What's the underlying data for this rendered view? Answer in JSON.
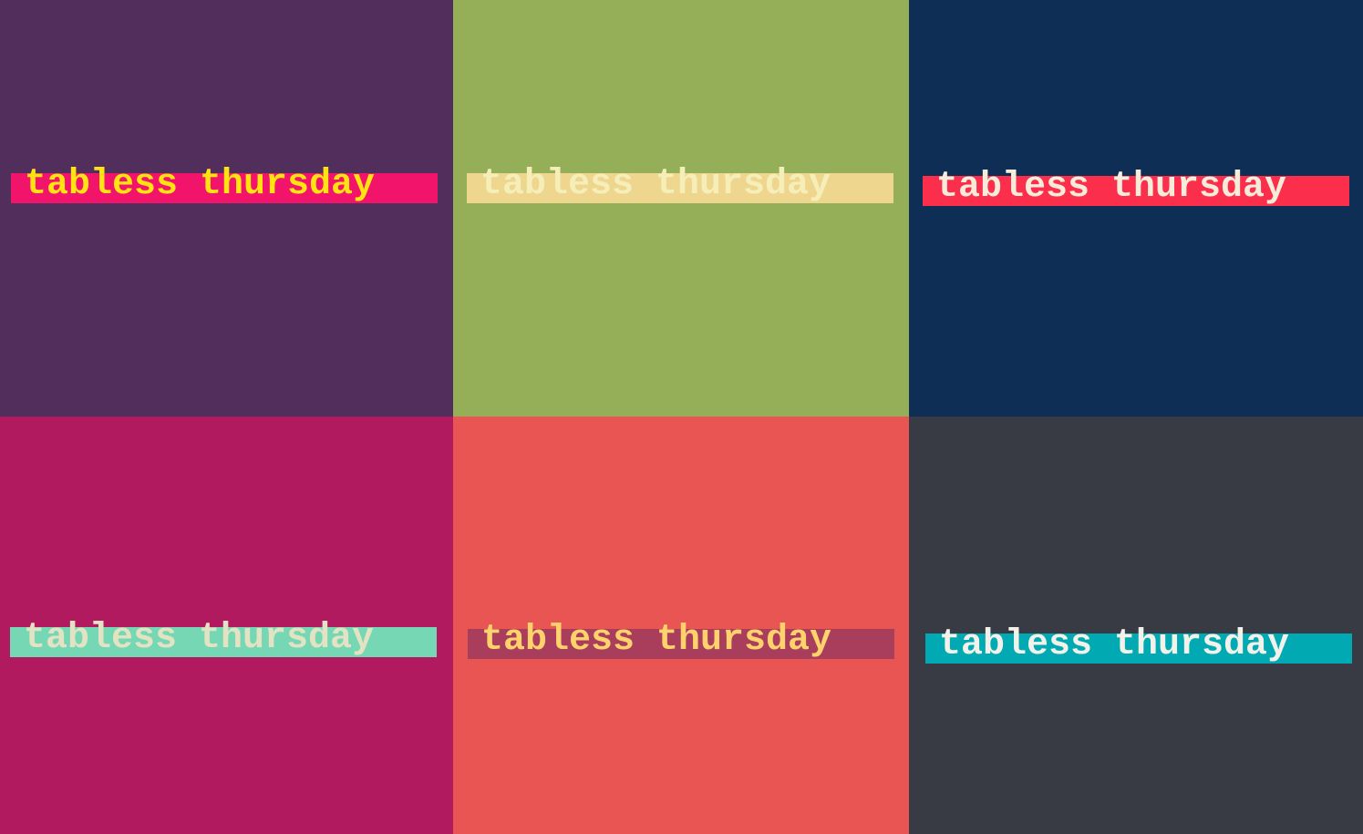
{
  "panels": [
    {
      "text": "tabless thursday",
      "background": "#522e5c",
      "band": "#f2136a",
      "text_color": "#ffe411"
    },
    {
      "text": "tabless thursday",
      "background": "#95ae58",
      "band": "#efd68e",
      "text_color": "#f6eeb8"
    },
    {
      "text": "tabless thursday",
      "background": "#0f2e55",
      "band": "#fb2e4c",
      "text_color": "#f6ecd9"
    },
    {
      "text": "tabless thursday",
      "background": "#b21a60",
      "band": "#76d7b4",
      "text_color": "#e3e2c2"
    },
    {
      "text": "tabless thursday",
      "background": "#e85553",
      "band": "#a93d5c",
      "text_color": "#ffd26b"
    },
    {
      "text": "tabless thursday",
      "background": "#383b43",
      "band": "#01a9b3",
      "text_color": "#f2f1ea"
    }
  ]
}
